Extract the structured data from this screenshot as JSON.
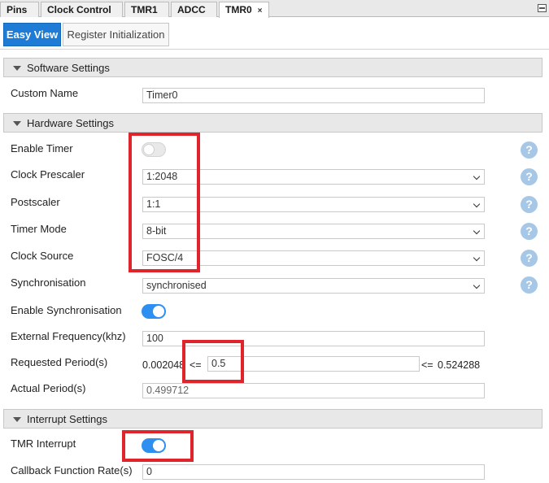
{
  "tabs": [
    {
      "label": "Pins",
      "active": false
    },
    {
      "label": "Clock Control",
      "active": false
    },
    {
      "label": "TMR1",
      "active": false
    },
    {
      "label": "ADCC",
      "active": false
    },
    {
      "label": "TMR0",
      "active": true,
      "close": "×"
    }
  ],
  "view_tabs": {
    "easy_view": "Easy View",
    "register_init": "Register Initialization"
  },
  "sections": {
    "software": "Software Settings",
    "hardware": "Hardware Settings",
    "interrupt": "Interrupt Settings"
  },
  "software": {
    "custom_name_label": "Custom Name",
    "custom_name_value": "Timer0"
  },
  "hardware": {
    "enable_timer_label": "Enable Timer",
    "enable_timer_on": false,
    "clock_prescaler_label": "Clock Prescaler",
    "clock_prescaler_value": "1:2048",
    "postscaler_label": "Postscaler",
    "postscaler_value": "1:1",
    "timer_mode_label": "Timer Mode",
    "timer_mode_value": "8-bit",
    "clock_source_label": "Clock Source",
    "clock_source_value": "FOSC/4",
    "synchronisation_label": "Synchronisation",
    "synchronisation_value": "synchronised",
    "enable_sync_label": "Enable Synchronisation",
    "enable_sync_on": true,
    "ext_freq_label": "External Frequency(khz)",
    "ext_freq_value": "100",
    "requested_period_label": "Requested Period(s)",
    "requested_period_min": "0.002048",
    "requested_period_le1": "<=",
    "requested_period_value": "0.5",
    "requested_period_le2": "<=",
    "requested_period_max": "0.524288",
    "actual_period_label": "Actual Period(s)",
    "actual_period_value": "0.499712"
  },
  "interrupt": {
    "tmr_interrupt_label": "TMR Interrupt",
    "tmr_interrupt_on": true,
    "callback_rate_label": "Callback Function Rate(s)",
    "callback_rate_value": "0"
  },
  "help_glyph": "?",
  "colors": {
    "accent": "#1e7bd6",
    "toggle_on": "#2d8ff0",
    "highlight": "#e0242b",
    "help": "#a7c7e6"
  }
}
